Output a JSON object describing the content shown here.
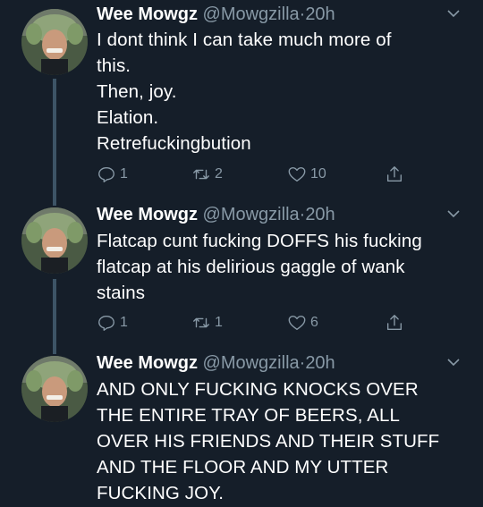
{
  "tweets": [
    {
      "name": "Wee Mowgz",
      "handle": "@Mowgzilla",
      "dot": "·",
      "time": "20h",
      "lines": [
        "I dont think I can take much more of",
        "this.",
        "Then, joy.",
        "Elation.",
        "Retrefuckingbution"
      ],
      "replies": "1",
      "retweets": "2",
      "likes": "10"
    },
    {
      "name": "Wee Mowgz",
      "handle": "@Mowgzilla",
      "dot": "·",
      "time": "20h",
      "lines": [
        "Flatcap cunt fucking DOFFS his fucking",
        "flatcap at his delirious gaggle of wank",
        "stains"
      ],
      "replies": "1",
      "retweets": "1",
      "likes": "6"
    },
    {
      "name": "Wee Mowgz",
      "handle": "@Mowgzilla",
      "dot": "·",
      "time": "20h",
      "lines": [
        "AND ONLY FUCKING KNOCKS OVER",
        "THE ENTIRE TRAY OF BEERS, ALL",
        "OVER HIS FRIENDS AND THEIR STUFF",
        "AND THE FLOOR AND MY UTTER",
        "FUCKING JOY."
      ]
    }
  ],
  "icons": {
    "reply": "reply-icon",
    "retweet": "retweet-icon",
    "like": "heart-icon",
    "share": "share-icon",
    "caret": "chevron-down-icon",
    "avatar": "avatar"
  },
  "colors": {
    "background": "#151e29",
    "secondary_text": "#8899a6",
    "thread_line": "#3d5466",
    "primary_text": "#ffffff"
  }
}
